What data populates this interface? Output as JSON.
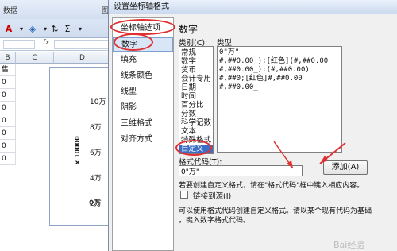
{
  "excel": {
    "ribbon_tab_label": "数据",
    "ribbon_tab_right": "图",
    "col_headers": [
      "B",
      "C",
      "D"
    ],
    "rows": [
      "售",
      "0",
      "0",
      "0",
      "0",
      "0",
      "0",
      "0"
    ],
    "fx_label": "fx",
    "chart": {
      "y_title": "x 10000",
      "ticks": [
        "10万",
        "8万",
        "6万",
        "4万",
        "2万",
        "0万"
      ]
    }
  },
  "dialog": {
    "title": "设置坐标轴格式",
    "nav_items": [
      "坐标轴选项",
      "数字",
      "填充",
      "线条颜色",
      "线型",
      "阴影",
      "三维格式",
      "对齐方式"
    ],
    "selected_nav_index": 1,
    "panel_title": "数字",
    "category_label": "类别(C):",
    "categories": [
      "常规",
      "数字",
      "货币",
      "会计专用",
      "日期",
      "时间",
      "百分比",
      "分数",
      "科学记数",
      "文本",
      "特殊格式",
      "自定义"
    ],
    "selected_category_index": 11,
    "type_label": "类型",
    "types": [
      "0\"万\"",
      "#,##0.00_);[红色](#,##0.00",
      "#,##0.00_);(#,##0.00)",
      "#,##0;[红色]#,##0.00",
      "#,##0.00_"
    ],
    "format_code_label": "格式代码(T):",
    "format_code_value": "0\"万\"",
    "add_button": "添加(A)",
    "help_text": "若要创建自定义格式，请在\"格式代码\"框中键入相应内容。",
    "link_label": "链接到源(I)",
    "desc_text1": "可以使用格式代码创建自定义格式。请以某个现有代码为基础",
    "desc_text2": "，键入数字格式代码。"
  },
  "watermark": "Bai经验"
}
